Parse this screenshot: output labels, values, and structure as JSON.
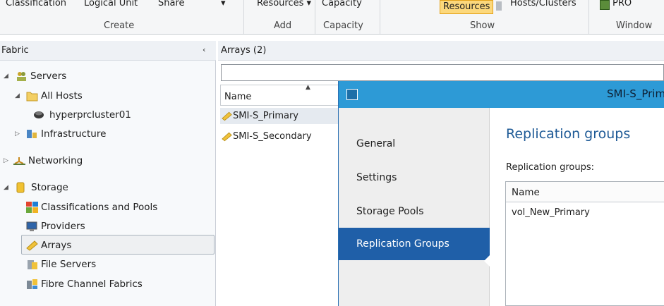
{
  "ribbon": {
    "items": {
      "classification": "Classification",
      "logical_unit": "Logical Unit",
      "share": "Share",
      "dropdown_arrow": "▾",
      "resources": "Resources ▾",
      "capacity": "Capacity",
      "resources_highlight": "Resources",
      "hosts_clusters": "Hosts/Clusters",
      "pro": "PRO"
    },
    "groups": {
      "create": "Create",
      "add": "Add",
      "capacity": "Capacity",
      "show": "Show",
      "window": "Window"
    },
    "highlight_color": "#fcd87c"
  },
  "fabric": {
    "title": "Fabric",
    "collapse_glyph": "‹",
    "tree": {
      "servers": "Servers",
      "all_hosts": "All Hosts",
      "cluster": "hyperprcluster01",
      "infrastructure": "Infrastructure",
      "networking": "Networking",
      "storage": "Storage",
      "classifications": "Classifications and Pools",
      "providers": "Providers",
      "arrays": "Arrays",
      "file_servers": "File Servers",
      "fibre_channel": "Fibre Channel Fabrics"
    }
  },
  "arrays": {
    "title": "Arrays (2)",
    "search_value": "",
    "column": "Name",
    "rows": [
      "SMI-S_Primary",
      "SMI-S_Secondary"
    ]
  },
  "dialog": {
    "title": "SMI-S_Primary",
    "title_bar_color": "#2d9ad6",
    "nav": {
      "general": "General",
      "settings": "Settings",
      "storage_pools": "Storage Pools",
      "replication_groups": "Replication Groups"
    },
    "active_nav_color": "#1f5fa8",
    "content": {
      "heading": "Replication groups",
      "label": "Replication groups:",
      "column": "Name",
      "rows": [
        "vol_New_Primary"
      ]
    }
  }
}
